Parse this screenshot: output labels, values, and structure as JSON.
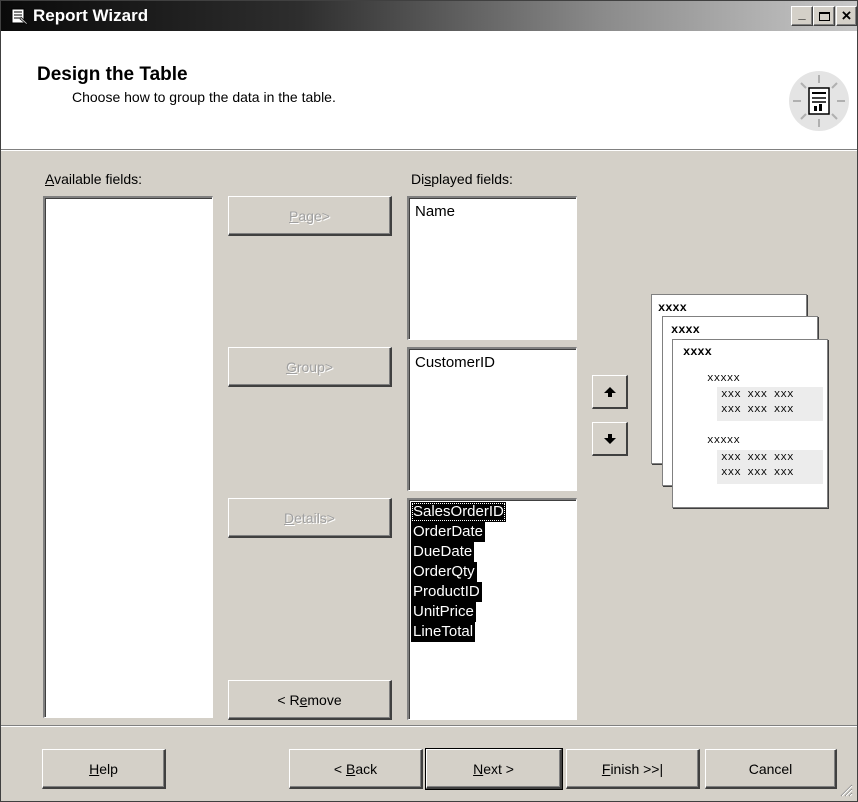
{
  "window": {
    "title": "Report Wizard",
    "controls": {
      "minimize": "_",
      "maximize": "□",
      "close": "×"
    }
  },
  "header": {
    "title": "Design the Table",
    "subtitle": "Choose how to group the data in the table."
  },
  "available": {
    "label_prefix": "A",
    "label_rest": "vailable fields:",
    "items": []
  },
  "displayed": {
    "label_pre": "Di",
    "label_u": "s",
    "label_post": "played fields:",
    "page_items": [
      "Name"
    ],
    "group_items": [
      "CustomerID"
    ],
    "detail_items": [
      "SalesOrderID",
      "OrderDate",
      "DueDate",
      "OrderQty",
      "ProductID",
      "UnitPrice",
      "LineTotal"
    ]
  },
  "buttons": {
    "page": {
      "u": "P",
      "rest": "age>"
    },
    "group": {
      "u": "G",
      "rest": "roup>"
    },
    "details": {
      "u": "D",
      "rest": "etails>"
    },
    "remove": {
      "pre": "< R",
      "u": "e",
      "rest": "move"
    },
    "help": {
      "u": "H",
      "rest": "elp"
    },
    "back": {
      "pre": "< ",
      "u": "B",
      "rest": "ack"
    },
    "next": {
      "u": "N",
      "rest": "ext >"
    },
    "finish": {
      "u": "F",
      "rest": "inish >>|"
    },
    "cancel": "Cancel"
  },
  "preview": {
    "header1": "xxxx",
    "header2": "xxxx",
    "header3": "xxxx",
    "group_label": "xxxxx",
    "row": "xxx xxx xxx"
  },
  "icons": {
    "title": "report-wizard-icon",
    "header": "report-lightbulb-icon",
    "move_up": "arrow-up-icon",
    "move_down": "arrow-down-icon"
  }
}
